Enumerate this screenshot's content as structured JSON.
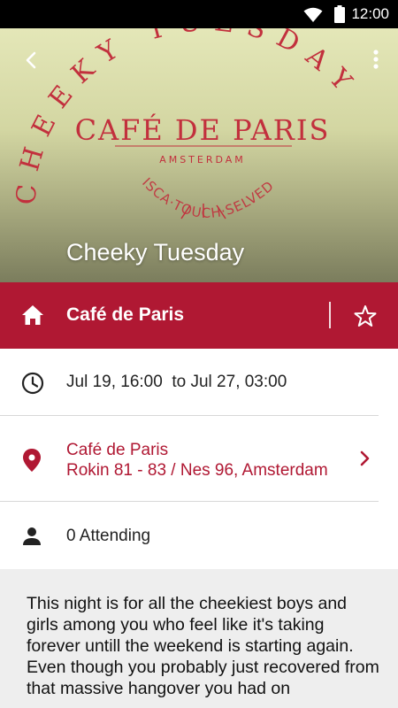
{
  "status_bar": {
    "time": "12:00",
    "icons": [
      "wifi-icon",
      "battery-icon"
    ]
  },
  "hero": {
    "event_title": "Cheeky Tuesday",
    "artwork_text": {
      "arc": "CHEEKY TUESDAY",
      "logo": "CAFÉ DE PARIS",
      "subtitle": "AMSTERDAM",
      "bottom": "ISCA·TOUCH·SELVEDGE"
    },
    "icons": [
      "back-arrow-icon",
      "overflow-menu-icon"
    ]
  },
  "venue_bar": {
    "name": "Café de Paris",
    "accent_color": "#b01833",
    "icons": [
      "home-icon",
      "star-outline-icon"
    ]
  },
  "details": {
    "date_range": "Jul 19, 16:00  to Jul 27, 03:00",
    "location_name": "Café de Paris",
    "location_address": "Rokin 81 - 83 / Nes 96, Amsterdam",
    "attending": "0 Attending"
  },
  "description": "This night is for all the cheekiest boys and girls among you who feel like it's taking forever untill the weekend is starting again.\nEven though you probably just recovered from that massive hangover you had on"
}
